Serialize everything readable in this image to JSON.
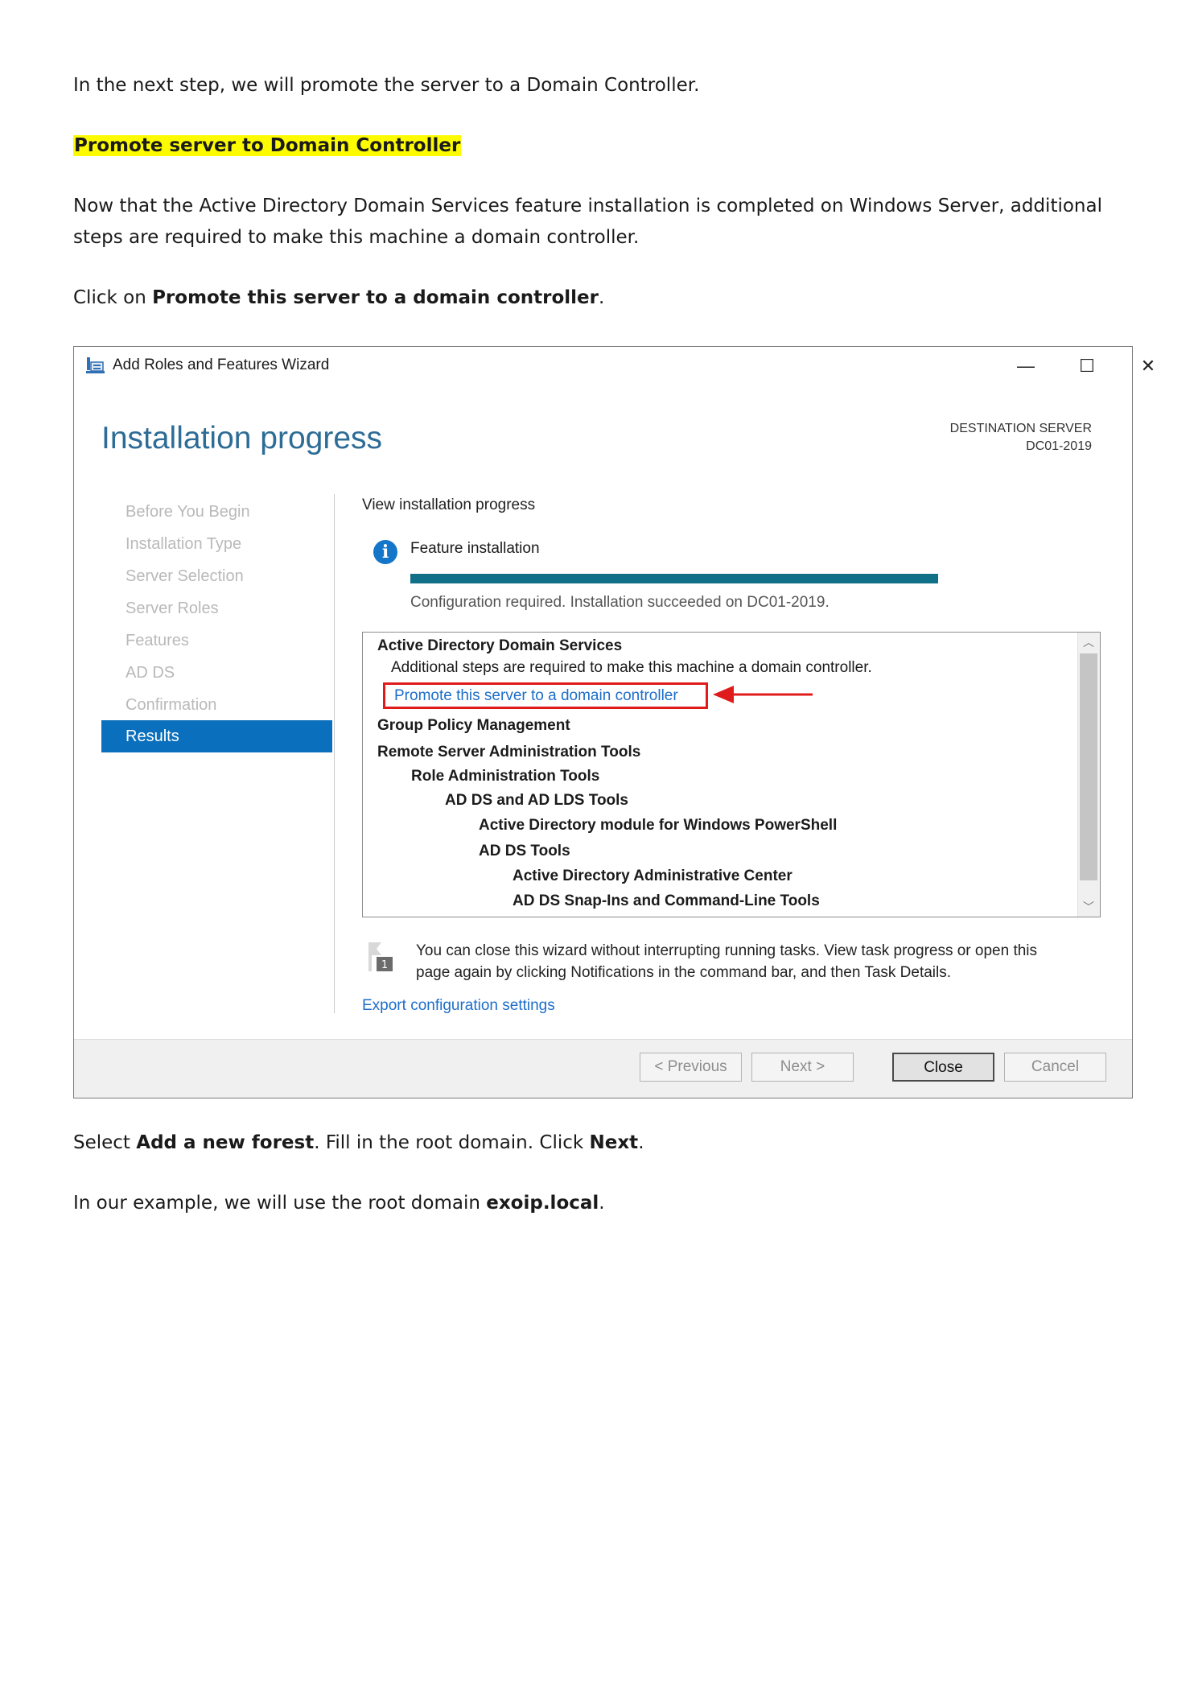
{
  "doc": {
    "intro": "In the next step, we will promote the server to a Domain Controller.",
    "section_heading": "Promote server to Domain Controller",
    "para_line1": "Now that the Active Directory Domain Services feature installation is completed on Windows Server, additional",
    "para_line2": "steps are required to make this machine a domain controller.",
    "click_prefix": "Click on ",
    "click_bold": "Promote this server to a domain controller",
    "click_suffix": ".",
    "select_prefix": "Select ",
    "select_bold": "Add a new forest",
    "select_middle": ". Fill in the root domain. Click ",
    "select_bold2": "Next",
    "select_suffix": ".",
    "example_prefix": "In our example, we will use the root domain ",
    "example_bold": "exoip.local",
    "example_suffix": "."
  },
  "wizard": {
    "title": "Add Roles and Features Wizard",
    "controls": {
      "minimize": "—",
      "maximize": "☐",
      "close": "✕"
    },
    "page_heading": "Installation progress",
    "destination_label": "DESTINATION SERVER",
    "destination_server": "DC01-2019",
    "nav": [
      {
        "label": "Before You Begin"
      },
      {
        "label": "Installation Type"
      },
      {
        "label": "Server Selection"
      },
      {
        "label": "Server Roles"
      },
      {
        "label": "Features"
      },
      {
        "label": "AD DS"
      },
      {
        "label": "Confirmation"
      },
      {
        "label": "Results"
      }
    ],
    "view_progress": "View installation progress",
    "feature_label": "Feature installation",
    "progress_percent": 100,
    "status": "Configuration required. Installation succeeded on DC01-2019.",
    "results": {
      "adds": "Active Directory Domain Services",
      "adds_note": "Additional steps are required to make this machine a domain controller.",
      "promote_link": "Promote this server to a domain controller",
      "gpm": "Group Policy Management",
      "rsat": "Remote Server Administration Tools",
      "role_admin": "Role Administration Tools",
      "adds_lds": "AD DS and AD LDS Tools",
      "ad_ps": "Active Directory module for Windows PowerShell",
      "adds_tools": "AD DS Tools",
      "adac": "Active Directory Administrative Center",
      "snapins": "AD DS Snap-Ins and Command-Line Tools"
    },
    "flag_number": "1",
    "note_line1": "You can close this wizard without interrupting running tasks. View task progress or open this",
    "note_line2": "page again by clicking Notifications in the command bar, and then Task Details.",
    "export_link": "Export configuration settings",
    "buttons": {
      "previous": "< Previous",
      "next": "Next >",
      "close": "Close",
      "cancel": "Cancel"
    },
    "colors": {
      "accent": "#0a6fbc",
      "heading": "#2d6c96",
      "progress": "#0f7087",
      "annotation_red": "#e01b1b",
      "link": "#1d6ec9"
    }
  }
}
